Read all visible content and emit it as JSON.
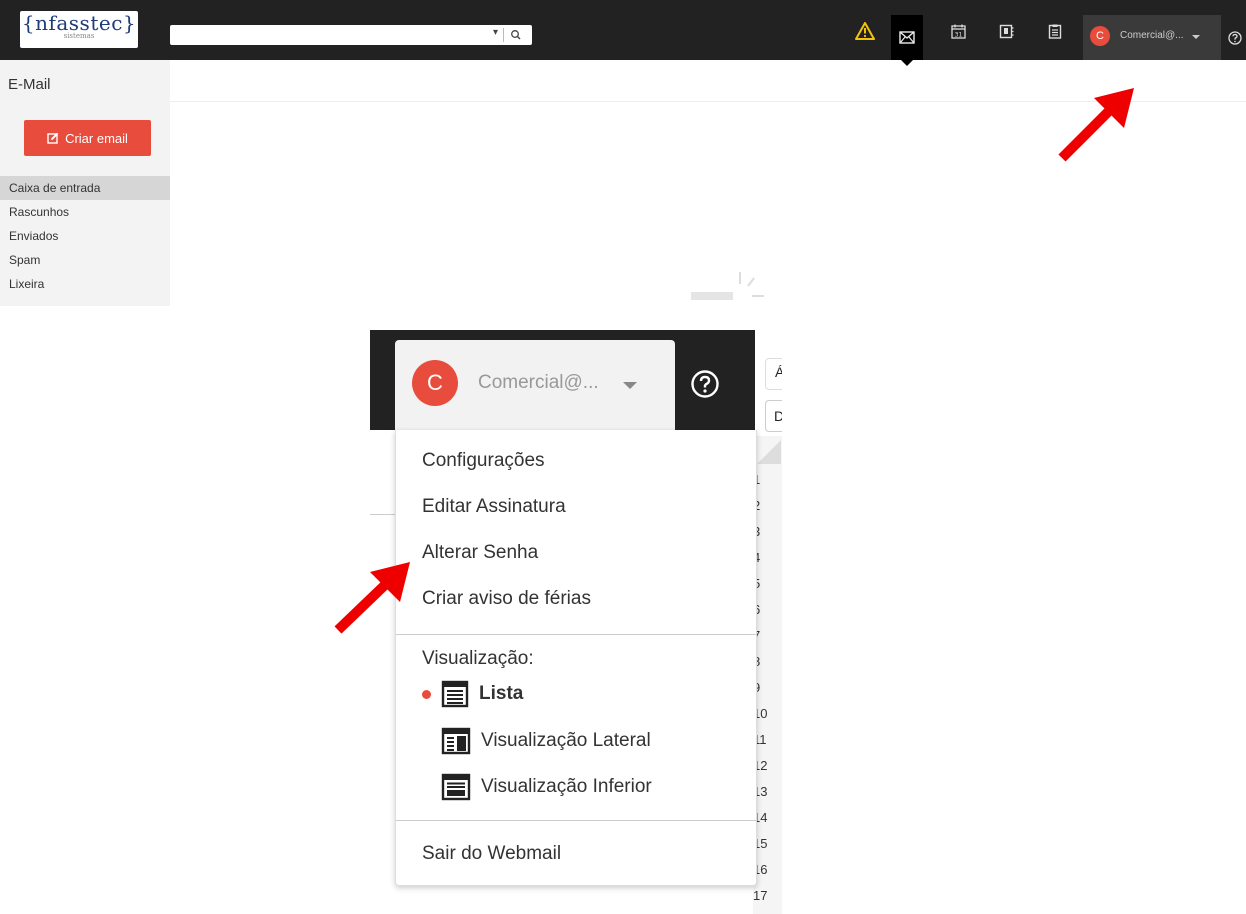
{
  "topbar": {
    "logo_main": "{nfasstec}",
    "logo_sub": "sistemas",
    "search_dropdown": "▾",
    "icons": [
      "warning-icon",
      "mail-icon",
      "calendar-icon",
      "contacts-icon",
      "notes-icon",
      "help-icon"
    ],
    "calendar_day": "31",
    "user": {
      "avatar_letter": "C",
      "name": "Comercial@..."
    }
  },
  "sidebar": {
    "title": "E-Mail",
    "compose_label": "Criar email",
    "folders": [
      "Caixa de entrada",
      "Rascunhos",
      "Enviados",
      "Spam",
      "Lixeira"
    ],
    "active_folder": "Caixa de entrada"
  },
  "zoom": {
    "avatar_letter": "C",
    "user_name": "Comercial@...",
    "side_letters": {
      "a": "Á",
      "d": "D"
    },
    "line_numbers": [
      "1",
      "2",
      "3",
      "4",
      "5",
      "6",
      "7",
      "8",
      "9",
      "10",
      "11",
      "12",
      "13",
      "14",
      "15",
      "16",
      "17"
    ],
    "menu": {
      "items": [
        "Configurações",
        "Editar Assinatura",
        "Alterar Senha",
        "Criar aviso de férias"
      ],
      "view_label": "Visualização:",
      "views": [
        "Lista",
        "Visualização Lateral",
        "Visualização Inferior"
      ],
      "selected_view": "Lista",
      "logout": "Sair do Webmail"
    }
  },
  "colors": {
    "topbar": "#222222",
    "accent": "#e74c3c",
    "annotation_arrow": "#ee0000",
    "warning": "#f1c40f"
  }
}
